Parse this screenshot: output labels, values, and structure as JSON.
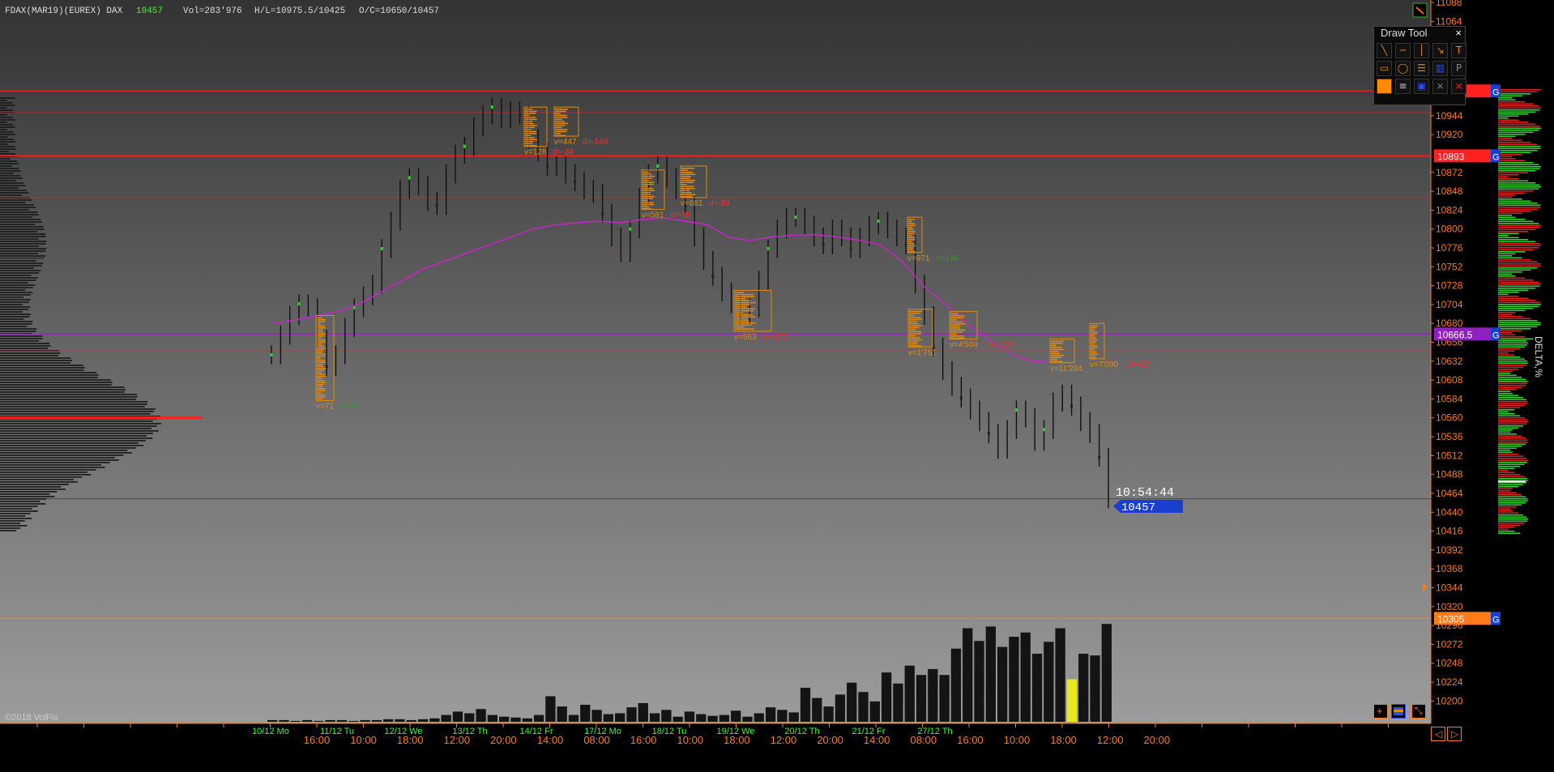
{
  "header": {
    "instrument": "FDAX(MAR19)(EUREX) DAX",
    "last_price": "10457",
    "volume": "Vol=283'976",
    "high_low": "H/L=10975.5/10425",
    "open_close": "O/C=10650/10457",
    "colors": {
      "last_price": "#33ff33",
      "text": "#dddddd"
    }
  },
  "draw_tool": {
    "title": "Draw Tool",
    "close_glyph": "×",
    "tools": [
      {
        "name": "line-tool-icon"
      },
      {
        "name": "horizontal-line-tool-icon"
      },
      {
        "name": "vertical-line-tool-icon"
      },
      {
        "name": "ray-tool-icon"
      },
      {
        "name": "text-tool-icon"
      },
      {
        "name": "rectangle-tool-icon"
      },
      {
        "name": "ellipse-tool-icon"
      },
      {
        "name": "fibonacci-tool-icon"
      },
      {
        "name": "volume-profile-tool-icon"
      },
      {
        "name": "price-label-tool-icon"
      },
      {
        "name": "fill-color-icon"
      },
      {
        "name": "line-style-icon"
      },
      {
        "name": "frame-color-icon"
      },
      {
        "name": "delete-tool-icon"
      },
      {
        "name": "delete-all-icon"
      }
    ]
  },
  "copyright": "©2018 VolFix",
  "side_label": "DELTA,%",
  "clock": "10:54:44",
  "current_price_label": "10457",
  "level_labels": {
    "level_10893": "10893",
    "level_10666": "10666.5",
    "level_10305": "10305",
    "g_marker": "G"
  },
  "colors": {
    "background_top": "#3a3a3a",
    "background_bottom": "#9a9a9a",
    "axis_text": "#ff7a1a",
    "date_text": "#33ff33",
    "resistance_line": "#ff2020",
    "vwap_line": "#d020d0",
    "level_purple": "#9020c0",
    "current_price": "#1a3fd0",
    "profile_bar": "#e08a10",
    "delta_positive": "#30d030",
    "delta_negative": "#e02020"
  },
  "chart_data": {
    "type": "bar",
    "description_symbol": "FDAX(MAR19)(EUREX) DAX",
    "y_axis": {
      "ylim": [
        10188,
        11088
      ],
      "ticks": [
        11088,
        11064,
        10944,
        10920,
        10872,
        10848,
        10824,
        10800,
        10776,
        10752,
        10728,
        10704,
        10680,
        10656,
        10632,
        10608,
        10584,
        10560,
        10536,
        10512,
        10488,
        10464,
        10440,
        10416,
        10392,
        10368,
        10344,
        10320,
        10296,
        10272,
        10248,
        10224,
        10200
      ]
    },
    "x_axis": {
      "date_labels": [
        "10/12 Mo",
        "11/12 Tu",
        "12/12 We",
        "13/12 Th",
        "14/12 Fr",
        "17/12 Mo",
        "18/12 Tu",
        "19/12 We",
        "20/12 Th",
        "21/12 Fr",
        "27/12 Th"
      ],
      "time_labels": [
        "16:00",
        "10:00",
        "18:00",
        "12:00",
        "20:00",
        "14:00",
        "08:00",
        "16:00",
        "10:00",
        "18:00",
        "12:00",
        "20:00",
        "14:00",
        "08:00",
        "16:00",
        "10:00",
        "18:00",
        "12:00",
        "20:00"
      ]
    },
    "horizontal_levels": [
      {
        "price": 10975.5,
        "color": "#ff2020"
      },
      {
        "price": 10893,
        "color": "#ff2020"
      },
      {
        "price": 10948,
        "color": "#ff2020"
      },
      {
        "price": 10840,
        "color": "#ff2020"
      },
      {
        "price": 10762,
        "color": "#ff2020"
      },
      {
        "price": 10666.5,
        "color": "#9020c0"
      },
      {
        "price": 10645,
        "color": "#ff2020"
      },
      {
        "price": 10457,
        "color": "#202020"
      },
      {
        "price": 10305,
        "color": "#ff7a1a"
      }
    ],
    "price_series": [
      10640,
      10665,
      10690,
      10705,
      10700,
      10660,
      10625,
      10640,
      10675,
      10700,
      10715,
      10730,
      10775,
      10810,
      10850,
      10865,
      10855,
      10835,
      10830,
      10870,
      10895,
      10905,
      10930,
      10945,
      10955,
      10940,
      10950,
      10945,
      10915,
      10898,
      10880,
      10880,
      10870,
      10860,
      10850,
      10845,
      10820,
      10790,
      10770,
      10800,
      10840,
      10870,
      10880,
      10865,
      10850,
      10830,
      10790,
      10760,
      10740,
      10720,
      10705,
      10690,
      10700,
      10735,
      10775,
      10800,
      10815,
      10815,
      10805,
      10790,
      10780,
      10800,
      10790,
      10775,
      10790,
      10805,
      10810,
      10800,
      10790,
      10780,
      10730,
      10690,
      10650,
      10620,
      10600,
      10585,
      10570,
      10555,
      10540,
      10520,
      10545,
      10570,
      10560,
      10530,
      10545,
      10580,
      10590,
      10575,
      10555,
      10540,
      10510,
      10457
    ],
    "vwap_series": [
      10680,
      10684,
      10690,
      10695,
      10705,
      10720,
      10735,
      10750,
      10760,
      10770,
      10780,
      10790,
      10800,
      10805,
      10808,
      10810,
      10808,
      10812,
      10814,
      10810,
      10806,
      10790,
      10785,
      10790,
      10792,
      10793,
      10790,
      10786,
      10780,
      10760,
      10728,
      10705,
      10680,
      10660,
      10642,
      10632,
      10630
    ],
    "volume_bars": [
      2,
      2,
      1,
      2,
      1,
      2,
      2,
      1,
      2,
      2,
      3,
      3,
      2,
      3,
      4,
      8,
      12,
      10,
      15,
      8,
      6,
      5,
      4,
      8,
      30,
      18,
      8,
      20,
      14,
      9,
      10,
      17,
      22,
      10,
      14,
      6,
      12,
      9,
      7,
      8,
      13,
      6,
      10,
      17,
      14,
      11,
      40,
      28,
      18,
      32,
      46,
      35,
      24,
      58,
      45,
      66,
      55,
      62,
      55,
      86,
      110,
      95,
      112,
      88,
      100,
      105,
      80,
      94,
      110,
      50,
      80,
      78,
      115
    ],
    "volume_highlight_index": 69,
    "volume_profiles": [
      {
        "volume": "v=71",
        "delta": "d=76"
      },
      {
        "volume": "v=128",
        "delta": "d=-34"
      },
      {
        "volume": "v=447",
        "delta": "d=-149"
      },
      {
        "volume": "v=581",
        "delta": "d=-95"
      },
      {
        "volume": "v=881",
        "delta": "d=-89"
      },
      {
        "volume": "v=563",
        "delta": "d=-173"
      },
      {
        "volume": "v=971",
        "delta": "d=135"
      },
      {
        "volume": "v=1'751",
        "delta": ""
      },
      {
        "volume": "v=4'504",
        "delta": "d=-133"
      },
      {
        "volume": "v=11'284",
        "delta": ""
      },
      {
        "volume": "v=7'090",
        "delta": "d=-82"
      }
    ]
  }
}
